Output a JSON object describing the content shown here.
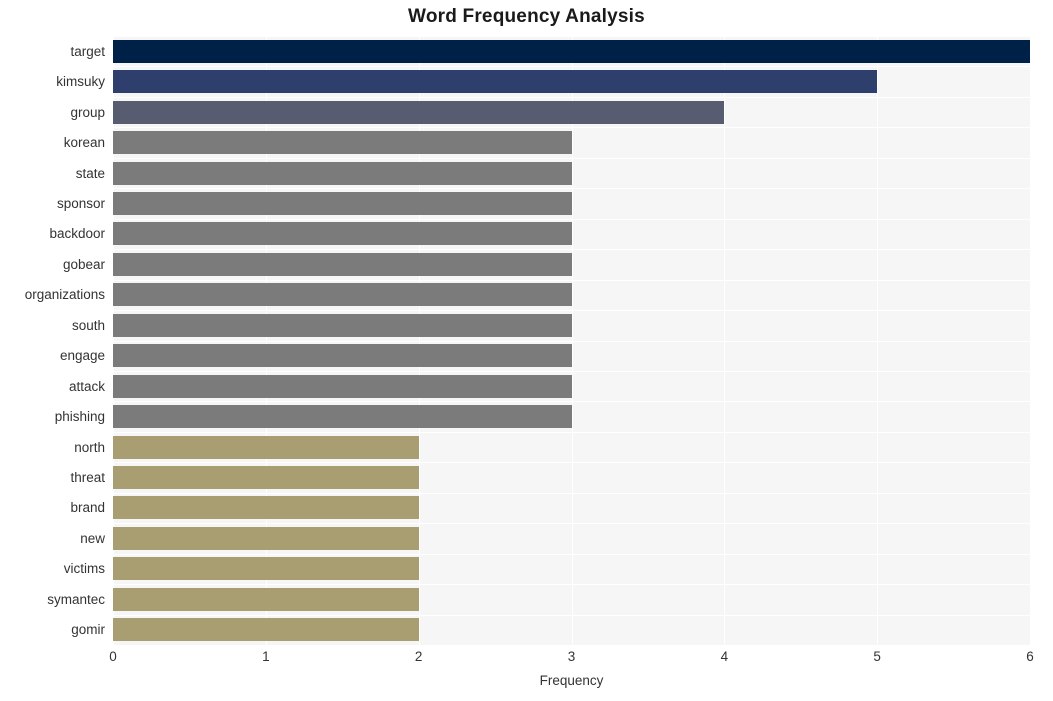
{
  "chart_data": {
    "type": "bar",
    "orientation": "horizontal",
    "title": "Word Frequency Analysis",
    "xlabel": "Frequency",
    "ylabel": "",
    "xlim": [
      0,
      6
    ],
    "xticks": [
      0,
      1,
      2,
      3,
      4,
      5,
      6
    ],
    "grid": true,
    "legend": "none",
    "categories": [
      "target",
      "kimsuky",
      "group",
      "korean",
      "state",
      "sponsor",
      "backdoor",
      "gobear",
      "organizations",
      "south",
      "engage",
      "attack",
      "phishing",
      "north",
      "threat",
      "brand",
      "new",
      "victims",
      "symantec",
      "gomir"
    ],
    "values": [
      6,
      5,
      4,
      3,
      3,
      3,
      3,
      3,
      3,
      3,
      3,
      3,
      3,
      2,
      2,
      2,
      2,
      2,
      2,
      2
    ],
    "bar_colors": [
      "#002147",
      "#2e3f6e",
      "#585c70",
      "#7b7b7b",
      "#7b7b7b",
      "#7b7b7b",
      "#7b7b7b",
      "#7b7b7b",
      "#7b7b7b",
      "#7b7b7b",
      "#7b7b7b",
      "#7b7b7b",
      "#7b7b7b",
      "#a99d72",
      "#a99d72",
      "#a99d72",
      "#a99d72",
      "#a99d72",
      "#a99d72",
      "#a99d72"
    ]
  },
  "style": {
    "plot_background": "#f6f6f7",
    "figure_background": "#ffffff",
    "gridline_color": "#ffffff",
    "tick_text_color": "#333333",
    "title_color": "#1a1a1a"
  }
}
